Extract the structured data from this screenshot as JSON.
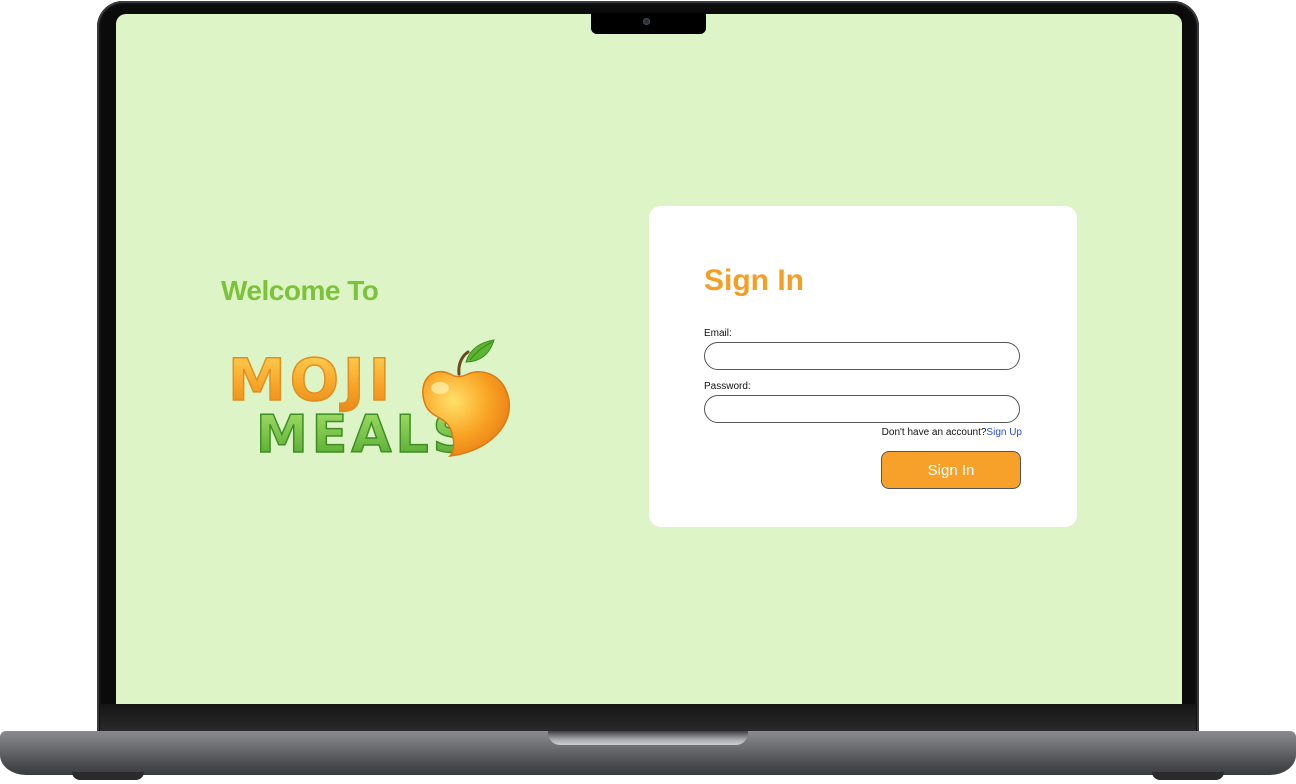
{
  "welcome": {
    "heading": "Welcome To",
    "logo_line1": "MOJI",
    "logo_line2": "MEALS"
  },
  "signin": {
    "title": "Sign In",
    "email_label": "Email:",
    "email_value": "",
    "password_label": "Password:",
    "password_value": "",
    "no_account_text": "Don't have an account?",
    "signup_link": "Sign Up",
    "submit_label": "Sign In"
  },
  "colors": {
    "screen_background": "#ddf4c6",
    "welcome_green": "#7cc33b",
    "title_orange": "#f59e24",
    "button_orange": "#f7a12a",
    "link_blue": "#2a4fd6"
  },
  "icons": [
    "apple-logo-icon",
    "camera-icon"
  ]
}
